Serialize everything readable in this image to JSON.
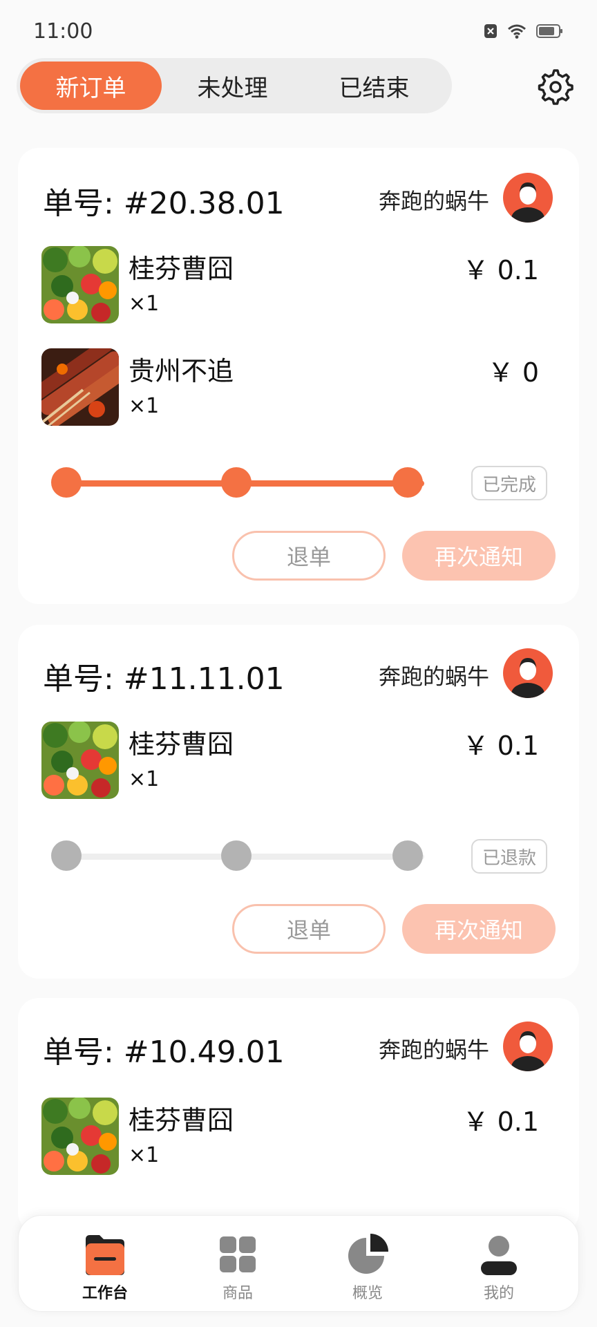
{
  "status_bar": {
    "time": "11:00"
  },
  "tabs": [
    {
      "label": "新订单",
      "active": true
    },
    {
      "label": "未处理",
      "active": false
    },
    {
      "label": "已结束",
      "active": false
    }
  ],
  "orders": [
    {
      "order_no": "单号: #20.38.01",
      "user": "奔跑的蜗牛",
      "items": [
        {
          "name": "桂芬曹囧",
          "qty": "×1",
          "price": "￥ 0.1"
        },
        {
          "name": "贵州不追",
          "qty": "×1",
          "price": "￥ 0"
        }
      ],
      "status": "已完成",
      "progress_color": "#f47143",
      "cancel_label": "退单",
      "notify_label": "再次通知"
    },
    {
      "order_no": "单号: #11.11.01",
      "user": "奔跑的蜗牛",
      "items": [
        {
          "name": "桂芬曹囧",
          "qty": "×1",
          "price": "￥ 0.1"
        }
      ],
      "status": "已退款",
      "progress_color": "#b3b3b3",
      "cancel_label": "退单",
      "notify_label": "再次通知"
    },
    {
      "order_no": "单号: #10.49.01",
      "user": "奔跑的蜗牛",
      "items": [
        {
          "name": "桂芬曹囧",
          "qty": "×1",
          "price": "￥ 0.1"
        }
      ]
    }
  ],
  "bottom_nav": [
    {
      "label": "工作台",
      "icon": "workbench-icon",
      "active": true
    },
    {
      "label": "商品",
      "icon": "grid-icon",
      "active": false
    },
    {
      "label": "概览",
      "icon": "pie-chart-icon",
      "active": false
    },
    {
      "label": "我的",
      "icon": "user-icon",
      "active": false
    }
  ],
  "colors": {
    "accent": "#f47143",
    "accent_light": "#fcc3b0",
    "inactive": "#b3b3b3"
  }
}
